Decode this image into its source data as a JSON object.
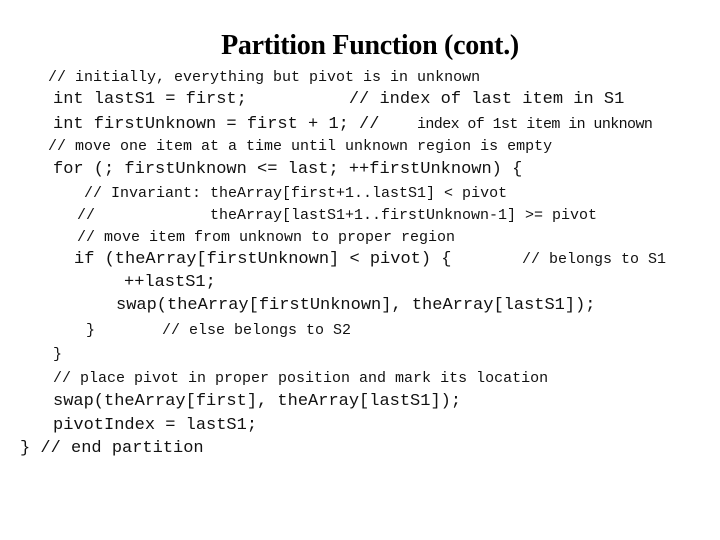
{
  "slide": {
    "title": "Partition Function (cont.)",
    "code_lines": [
      "// initially, everything but pivot is in unknown",
      "int lastS1 = first;          // index of last item in S1",
      "int firstUnknown = first + 1; //",
      "index of 1st item in unknown",
      "// move one item at a time until unknown region is empty",
      "for (; firstUnknown <= last; ++firstUnknown) {",
      "// Invariant: theArray[first+1..lastS1] < pivot",
      "//",
      "theArray[lastS1+1..firstUnknown-1] >= pivot",
      "// move item from unknown to proper region",
      "if (theArray[firstUnknown] < pivot) {",
      "// belongs to S1",
      "++lastS1;",
      "swap(theArray[firstUnknown], theArray[lastS1]);",
      "}",
      "// else belongs to S2",
      "}",
      "// place pivot in proper position and mark its location",
      "swap(theArray[first], theArray[lastS1]);",
      "pivotIndex = lastS1;",
      "} // end partition"
    ]
  }
}
